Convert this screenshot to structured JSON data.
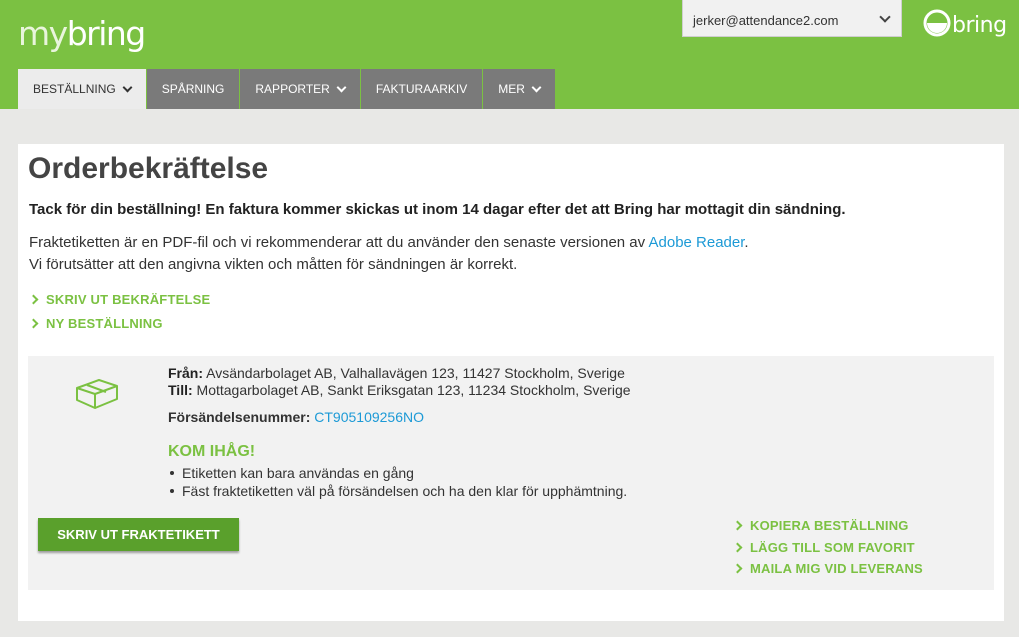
{
  "header": {
    "logo_my": "my",
    "logo_bring": "bring",
    "account_email": "jerker@attendance2.com",
    "brand_name": "bring"
  },
  "nav": {
    "items": [
      {
        "label": "BESTÄLLNING",
        "has_dropdown": true,
        "active": true
      },
      {
        "label": "SPÅRNING",
        "has_dropdown": false,
        "active": false
      },
      {
        "label": "RAPPORTER",
        "has_dropdown": true,
        "active": false
      },
      {
        "label": "FAKTURAARKIV",
        "has_dropdown": false,
        "active": false
      },
      {
        "label": "MER",
        "has_dropdown": true,
        "active": false
      }
    ]
  },
  "main": {
    "title": "Orderbekräftelse",
    "thanks": "Tack för din beställning! En faktura kommer skickas ut inom 14 dagar efter det att Bring har mottagit din sändning.",
    "info_line1": "Fraktetiketten är en PDF-fil och vi rekommenderar att du använder den senaste versionen av",
    "adobe_link": "Adobe Reader",
    "info_line1_end": ".",
    "info_line2": "Vi förutsätter att den angivna vikten och måtten för sändningen är korrekt.",
    "actions": {
      "print_confirmation": "SKRIV UT BEKRÄFTELSE",
      "new_order": "NY BESTÄLLNING"
    }
  },
  "shipment": {
    "from_label": "Från:",
    "from_value": "Avsändarbolaget AB, Valhallavägen 123, 11427 Stockholm, Sverige",
    "to_label": "Till:",
    "to_value": "Mottagarbolaget AB, Sankt Eriksgatan 123, 11234 Stockholm, Sverige",
    "number_label": "Försändelsenummer:",
    "number_value": "CT905109256NO",
    "remember_title": "KOM IHÅG!",
    "reminders": [
      "Etiketten kan bara användas en gång",
      "Fäst fraktetiketten väl på försändelsen och ha den klar för upphämtning."
    ],
    "print_label_button": "SKRIV UT FRAKTETIKETT",
    "side_actions": {
      "copy_order": "KOPIERA BESTÄLLNING",
      "add_favorite": "LÄGG TILL SOM FAVORIT",
      "email_on_delivery": "MAILA MIG VID LEVERANS"
    }
  },
  "colors": {
    "brand_green": "#7bc142",
    "button_green": "#5aa02c",
    "link_blue": "#1d9ad6",
    "nav_gray": "#7a7a7a"
  }
}
